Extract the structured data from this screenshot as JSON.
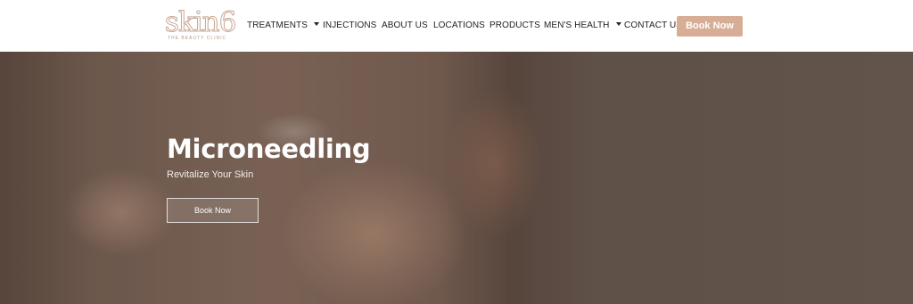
{
  "brand": {
    "logo_text": "skin6",
    "tagline": "THE BEAUTY CLINIC",
    "accent_color": "#d7ae95"
  },
  "nav": {
    "items": [
      {
        "label": "TREATMENTS",
        "has_dropdown": true
      },
      {
        "label": "INJECTIONS",
        "has_dropdown": false
      },
      {
        "label": "ABOUT US",
        "has_dropdown": false
      },
      {
        "label": "LOCATIONS",
        "has_dropdown": false
      },
      {
        "label": "PRODUCTS",
        "has_dropdown": false
      },
      {
        "label": "MEN'S HEALTH",
        "has_dropdown": true
      },
      {
        "label": "CONTACT US",
        "has_dropdown": false
      }
    ],
    "cta_label": "Book Now"
  },
  "hero": {
    "title": "Microneedling",
    "subtitle": "Revitalize Your Skin",
    "button_label": "Book Now"
  }
}
